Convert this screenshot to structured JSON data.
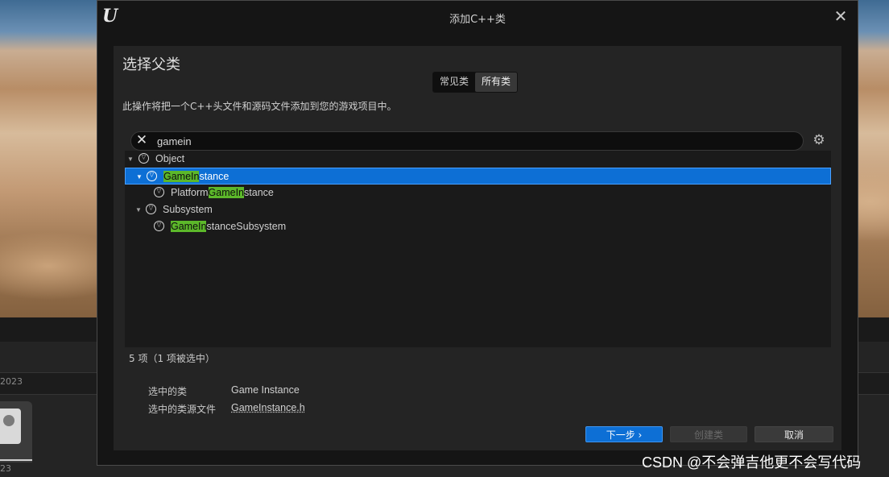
{
  "background": {
    "date_partial": "2023",
    "thumb_label_partial": "23"
  },
  "dialog": {
    "title": "添加C++类",
    "heading": "选择父类",
    "tabs": [
      {
        "label": "常见类",
        "active": false
      },
      {
        "label": "所有类",
        "active": true
      }
    ],
    "description": "此操作将把一个C++头文件和源码文件添加到您的游戏项目中。",
    "search": {
      "value": "gamein",
      "placeholder": ""
    },
    "tree": [
      {
        "pre": "Object",
        "match": "",
        "post": "",
        "expanded": true
      },
      {
        "pre": "",
        "match": "GameIn",
        "post": "stance",
        "expanded": true,
        "selected": true
      },
      {
        "pre": "Platform",
        "match": "GameIn",
        "post": "stance"
      },
      {
        "pre": "Subsystem",
        "match": "",
        "post": "",
        "expanded": true
      },
      {
        "pre": "",
        "match": "GameIn",
        "post": "stanceSubsystem"
      }
    ],
    "item_count": "5 项（1 项被选中）",
    "selected_class_label": "选中的类",
    "selected_class_value": "Game Instance",
    "source_file_label": "选中的类源文件",
    "source_file_value": "GameInstance.h",
    "buttons": {
      "next": "下一步 ›",
      "create": "创建类",
      "cancel": "取消"
    }
  },
  "watermark": "CSDN @不会弹吉他更不会写代码"
}
